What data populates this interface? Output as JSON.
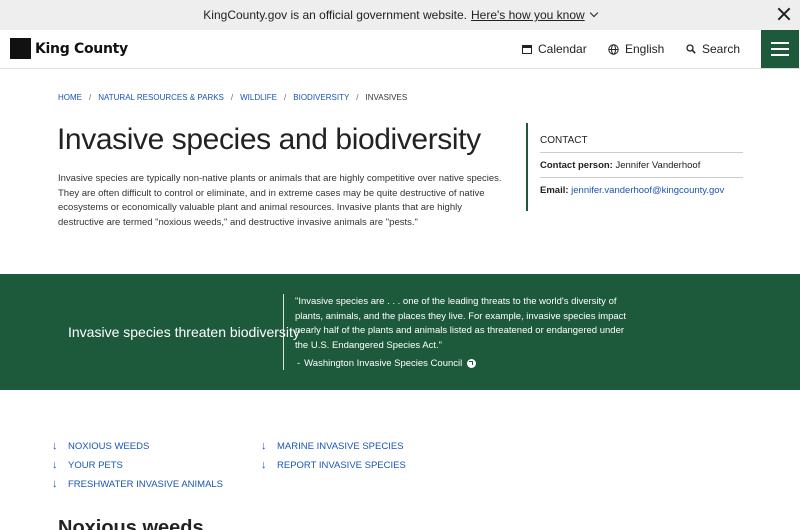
{
  "gov_banner": {
    "text": "KingCounty.gov is an official government website.",
    "link": "Here's how you know"
  },
  "header": {
    "logo_text": "King County",
    "calendar": "Calendar",
    "language": "English",
    "search": "Search"
  },
  "breadcrumb": [
    "HOME",
    "NATURAL RESOURCES & PARKS",
    "WILDLIFE",
    "BIODIVERSITY",
    "INVASIVES"
  ],
  "page": {
    "title": "Invasive species and biodiversity",
    "intro": "Invasive species are typically non-native plants or animals that are highly competitive over native species. They are often difficult to control or eliminate, and in extreme cases may be quite destructive of native ecosystems or economically valuable plant and animal resources. Invasive plants that are highly destructive are termed \"noxious weeds,\" and destructive invasive animals are \"pests.\""
  },
  "contact": {
    "heading": "CONTACT",
    "person_label": "Contact person:",
    "person": "Jennifer Vanderhoof",
    "email_label": "Email:",
    "email": "jennifer.vanderhoof@kingcounty.gov"
  },
  "band": {
    "title": "Invasive species threaten biodiversity",
    "quote": "\"Invasive species are . . . one of the leading threats to the world's diversity of plants, animals, and the places they live. For example, invasive species impact nearly half of the plants and animals listed as threatened or endangered under the U.S. Endangered Species Act.\"",
    "attribution_prefix": "-",
    "attribution_link": "Washington Invasive Species Council"
  },
  "jump_links": [
    "NOXIOUS WEEDS",
    "YOUR PETS",
    "FRESHWATER INVASIVE ANIMALS",
    "MARINE INVASIVE SPECIES",
    "REPORT INVASIVE SPECIES"
  ],
  "next_section_heading": "Noxious weeds",
  "colors": {
    "brand_green": "#1d5a3c",
    "link_blue": "#1a55b5",
    "banner_gray": "#eeeeee"
  },
  "icons": [
    "close-icon",
    "chevron-down-icon",
    "calendar-icon",
    "globe-icon",
    "search-icon",
    "hamburger-menu-icon",
    "external-link-icon",
    "arrow-down-icon"
  ]
}
